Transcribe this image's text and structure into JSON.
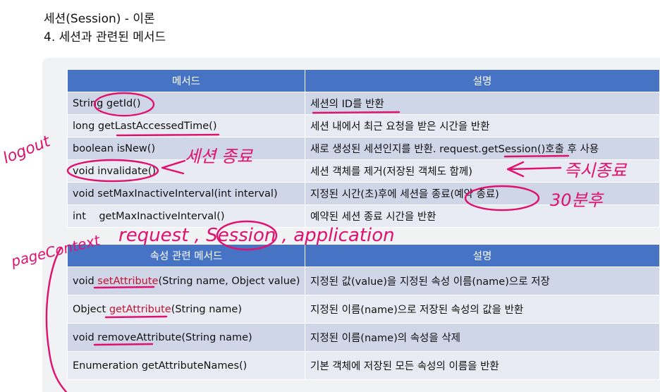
{
  "header": {
    "title": "세션(Session) - 이론",
    "subtitle": "4. 세션과 관련된 메서드"
  },
  "session_table": {
    "headers": [
      "메서드",
      "설명"
    ],
    "rows": [
      {
        "method": "String getId()",
        "desc": "세션의 ID를 반환"
      },
      {
        "method": "long getLastAccessedTime()",
        "desc": "세션 내에서 최근 요청을 받은 시간을 반환"
      },
      {
        "method": "boolean isNew()",
        "desc": "새로 생성된 세션인지를 반환. request.getSession()호출 후 사용"
      },
      {
        "method": "void invalidate()",
        "desc": "세션 객체를 제거(저장된 객체도 함께)"
      },
      {
        "method": "void setMaxInactiveInterval(int interval)",
        "desc": "지정된 시간(초)후에 세션을 종료(예약 종료)"
      },
      {
        "method": "int    getMaxInactiveInterval()",
        "desc": "예약된 세션 종료 시간을 반환"
      }
    ]
  },
  "attribute_table": {
    "headers": [
      "속성 관련 메서드",
      "설명"
    ],
    "rows": [
      {
        "method_prefix": "void ",
        "method_name": "setAttribute",
        "method_suffix": "(String name, Object value)",
        "desc": "지정된 값(value)을 지정된 속성 이름(name)으로 저장"
      },
      {
        "method_prefix": "Object ",
        "method_name": "getAttribute",
        "method_suffix": "(String name)",
        "desc": "지정된 이름(name)으로 저장된 속성의 값을 반환"
      },
      {
        "method_prefix": "void ",
        "method_name": "removeAttribute",
        "method_suffix": "(String name)",
        "desc": "지정된 이름(name)의 속성을 삭제"
      },
      {
        "method_prefix": "Enumeration ",
        "method_name": "getAttributeNames",
        "method_suffix": "()",
        "desc": "기본 객체에 저장된 모든 속성의 이름을 반환"
      }
    ]
  },
  "annotations": {
    "logout": "logout",
    "session_end": "세션 종료",
    "immediate_end": "즉시종료",
    "thirty_min": "30분후",
    "scopes": "request , Session , application",
    "pagecontext": "pageContext",
    "ink_color": "#e0106e"
  },
  "colors": {
    "header_blue": "#4773c5",
    "row_dark": "#cfd6e8",
    "row_light": "#e8ebf3",
    "highlight_red": "#c8102e"
  }
}
